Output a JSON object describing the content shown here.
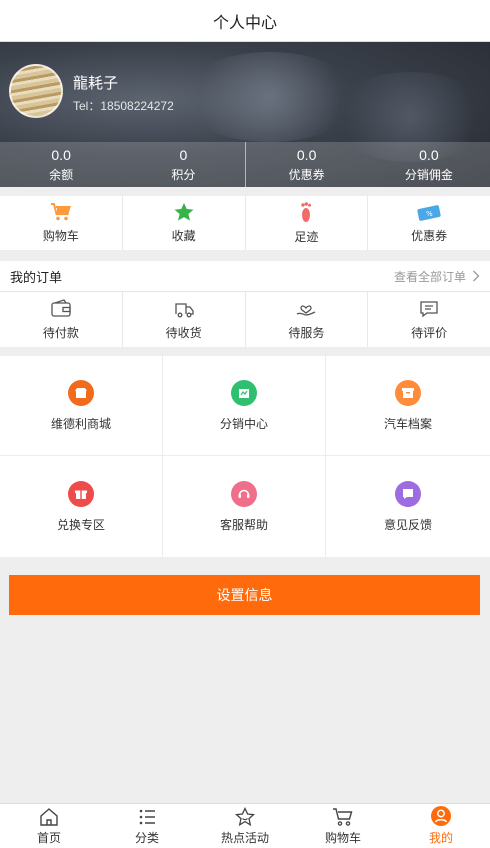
{
  "header": {
    "title": "个人中心"
  },
  "profile": {
    "username": "龍耗子",
    "tel": "Tel：18508224272"
  },
  "stats": [
    {
      "value": "0.0",
      "label": "余额"
    },
    {
      "value": "0",
      "label": "积分"
    },
    {
      "value": "0.0",
      "label": "优惠券"
    },
    {
      "value": "0.0",
      "label": "分销佣金"
    }
  ],
  "quick": [
    {
      "label": "购物车",
      "icon": "cart-icon",
      "color": "#ff9a3c"
    },
    {
      "label": "收藏",
      "icon": "star-icon",
      "color": "#36b44a"
    },
    {
      "label": "足迹",
      "icon": "footprint-icon",
      "color": "#f26b6b"
    },
    {
      "label": "优惠券",
      "icon": "coupon-icon",
      "color": "#4aa8e8"
    }
  ],
  "orders": {
    "title": "我的订单",
    "view_all": "查看全部订单",
    "items": [
      {
        "label": "待付款",
        "icon": "wallet-icon"
      },
      {
        "label": "待收货",
        "icon": "truck-icon"
      },
      {
        "label": "待服务",
        "icon": "service-hand-icon"
      },
      {
        "label": "待评价",
        "icon": "comment-icon"
      }
    ]
  },
  "grid": [
    {
      "label": "维德利商城",
      "icon": "store-icon",
      "color": "#f26b1d"
    },
    {
      "label": "分销中心",
      "icon": "distribution-icon",
      "color": "#2fbf71"
    },
    {
      "label": "汽车档案",
      "icon": "archive-icon",
      "color": "#ff8c3a"
    },
    {
      "label": "兑换专区",
      "icon": "gift-icon",
      "color": "#ef4b4b"
    },
    {
      "label": "客服帮助",
      "icon": "customer-service-icon",
      "color": "#ef6f8a"
    },
    {
      "label": "意见反馈",
      "icon": "feedback-icon",
      "color": "#9d6ce0"
    }
  ],
  "settings_label": "设置信息",
  "tabbar": [
    {
      "label": "首页",
      "icon": "home-icon"
    },
    {
      "label": "分类",
      "icon": "category-icon"
    },
    {
      "label": "热点活动",
      "icon": "hot-activity-icon"
    },
    {
      "label": "购物车",
      "icon": "cart-icon"
    },
    {
      "label": "我的",
      "icon": "user-icon",
      "active": true
    }
  ],
  "colors": {
    "accent": "#ff6b0c"
  }
}
